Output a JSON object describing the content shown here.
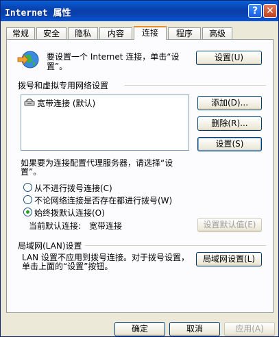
{
  "window": {
    "title": "Internet 属性",
    "help_glyph": "?",
    "close_glyph": "✕"
  },
  "tabs": [
    "常规",
    "安全",
    "隐私",
    "内容",
    "连接",
    "程序",
    "高级"
  ],
  "setup": {
    "text": "要设置一个 Internet 连接，单击“设置”。",
    "button": "设置(U)"
  },
  "dialup": {
    "heading": "拨号和虚拟专用网络设置",
    "items": [
      {
        "label": "宽带连接 (默认)"
      }
    ],
    "add_button": "添加(D)...",
    "remove_button": "删除(R)...",
    "settings_button": "设置(S)",
    "proxy_note": "如果要为连接配置代理服务器，请选择“设置”。",
    "options": [
      {
        "label": "从不进行拨号连接(C)",
        "checked": false
      },
      {
        "label": "不论网络连接是否存在都进行拨号(W)",
        "checked": false
      },
      {
        "label": "始终拨默认连接(O)",
        "checked": true
      }
    ],
    "current_default_label": "当前默认连接:",
    "current_default_value": "宽带连接",
    "set_default_button": "设置默认值(E)"
  },
  "lan": {
    "heading": "局域网(LAN)设置",
    "text": "LAN 设置不应用到拨号连接。对于拨号设置，单击上面的“设置”按钮。",
    "button": "局域网设置(L)"
  },
  "footer": {
    "ok": "确定",
    "cancel": "取消",
    "apply": "应用(A)"
  }
}
